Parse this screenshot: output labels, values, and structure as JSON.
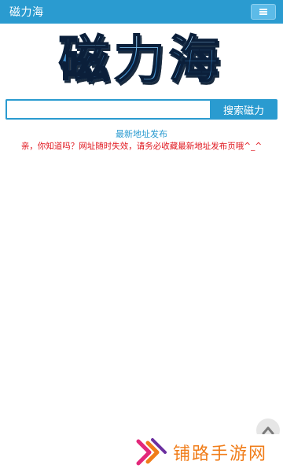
{
  "navbar": {
    "brand": "磁力海",
    "menu_icon": "hamburger-icon"
  },
  "logo": {
    "text": "磁力海"
  },
  "search": {
    "value": "",
    "placeholder": "",
    "button_label": "搜索磁力"
  },
  "links": {
    "latest_address": "最新地址发布"
  },
  "notice": "亲，你知道吗？网址随时失效，请务必收藏最新地址发布页哦^_^",
  "back_to_top_icon": "chevron-up-icon",
  "watermark": {
    "logo_icon": "double-chevron-logo-icon",
    "text": "铺路手游网"
  },
  "colors": {
    "primary": "#2a9bd0",
    "notice": "#e0151d",
    "watermark": "#f07d1a"
  }
}
